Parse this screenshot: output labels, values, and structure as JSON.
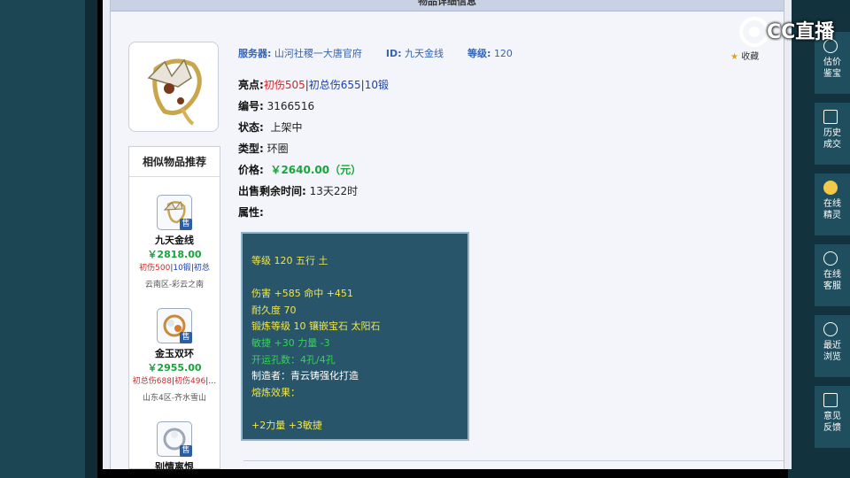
{
  "panel": {
    "header_title": "物品详细信息"
  },
  "info": {
    "server_label": "服务器:",
    "server_value": "山河社稷一大唐官府",
    "id_label": "ID:",
    "id_value": "九天金线",
    "level_label": "等级:",
    "level_value": "120",
    "fav_label": "收藏"
  },
  "details": {
    "highlight_label": "亮点:",
    "highlights": [
      "初伤505",
      "初总伤655",
      "10锻"
    ],
    "number_label": "编号:",
    "number_value": "3166516",
    "status_label": "状态:",
    "status_value": "上架中",
    "type_label": "类型:",
    "type_value": "环圈",
    "price_label": "价格:",
    "price_value": "￥2640.00（元）",
    "time_label": "出售剩余时间:",
    "time_value": "13天22时",
    "attr_label": "属性:"
  },
  "attributes": [
    {
      "text": "等级 120 五行 土",
      "color": "#f0e64c"
    },
    {
      "text": "",
      "color": "#ffffff"
    },
    {
      "text": "伤害 +585 命中 +451",
      "color": "#f0e64c"
    },
    {
      "text": "耐久度 70",
      "color": "#f0e64c"
    },
    {
      "text": "锻炼等级 10 镶嵌宝石 太阳石",
      "color": "#f0e64c"
    },
    {
      "text": "敏捷 +30 力量 -3",
      "color": "#2ed84c"
    },
    {
      "text": "开运孔数：4孔/4孔",
      "color": "#2ed84c"
    },
    {
      "text": "制造者：青云铸强化打造",
      "color": "#ffffff"
    },
    {
      "text": "熔炼效果：",
      "color": "#f0e64c"
    },
    {
      "text": "",
      "color": "#ffffff"
    },
    {
      "text": "+2力量 +3敏捷",
      "color": "#f0e64c"
    }
  ],
  "similar": {
    "title": "相似物品推荐",
    "sale_badge": "售",
    "items": [
      {
        "name": "九天金线",
        "price": "￥2818.00",
        "tags": [
          "初伤500",
          "10锻",
          "初总"
        ],
        "server": "云南区-彩云之南"
      },
      {
        "name": "金玉双环",
        "price": "￥2955.00",
        "tags": [
          "初总伤688",
          "初伤496",
          "…"
        ],
        "server": "山东4区-齐水雪山"
      },
      {
        "name": "别情离恨",
        "price": "",
        "tags": [],
        "server": ""
      }
    ]
  },
  "sidebar": {
    "items": [
      {
        "label": "估价\n鉴宝",
        "icon": "plus-icon"
      },
      {
        "label": "历史\n成交",
        "icon": "check-icon"
      },
      {
        "label": "在线\n精灵",
        "icon": "avatar-icon"
      },
      {
        "label": "在线\n客服",
        "icon": "headset-icon"
      },
      {
        "label": "最近\n浏览",
        "icon": "clock-icon"
      },
      {
        "label": "意见\n反馈",
        "icon": "edit-icon"
      }
    ]
  },
  "watermark": {
    "text": "CC直播"
  }
}
